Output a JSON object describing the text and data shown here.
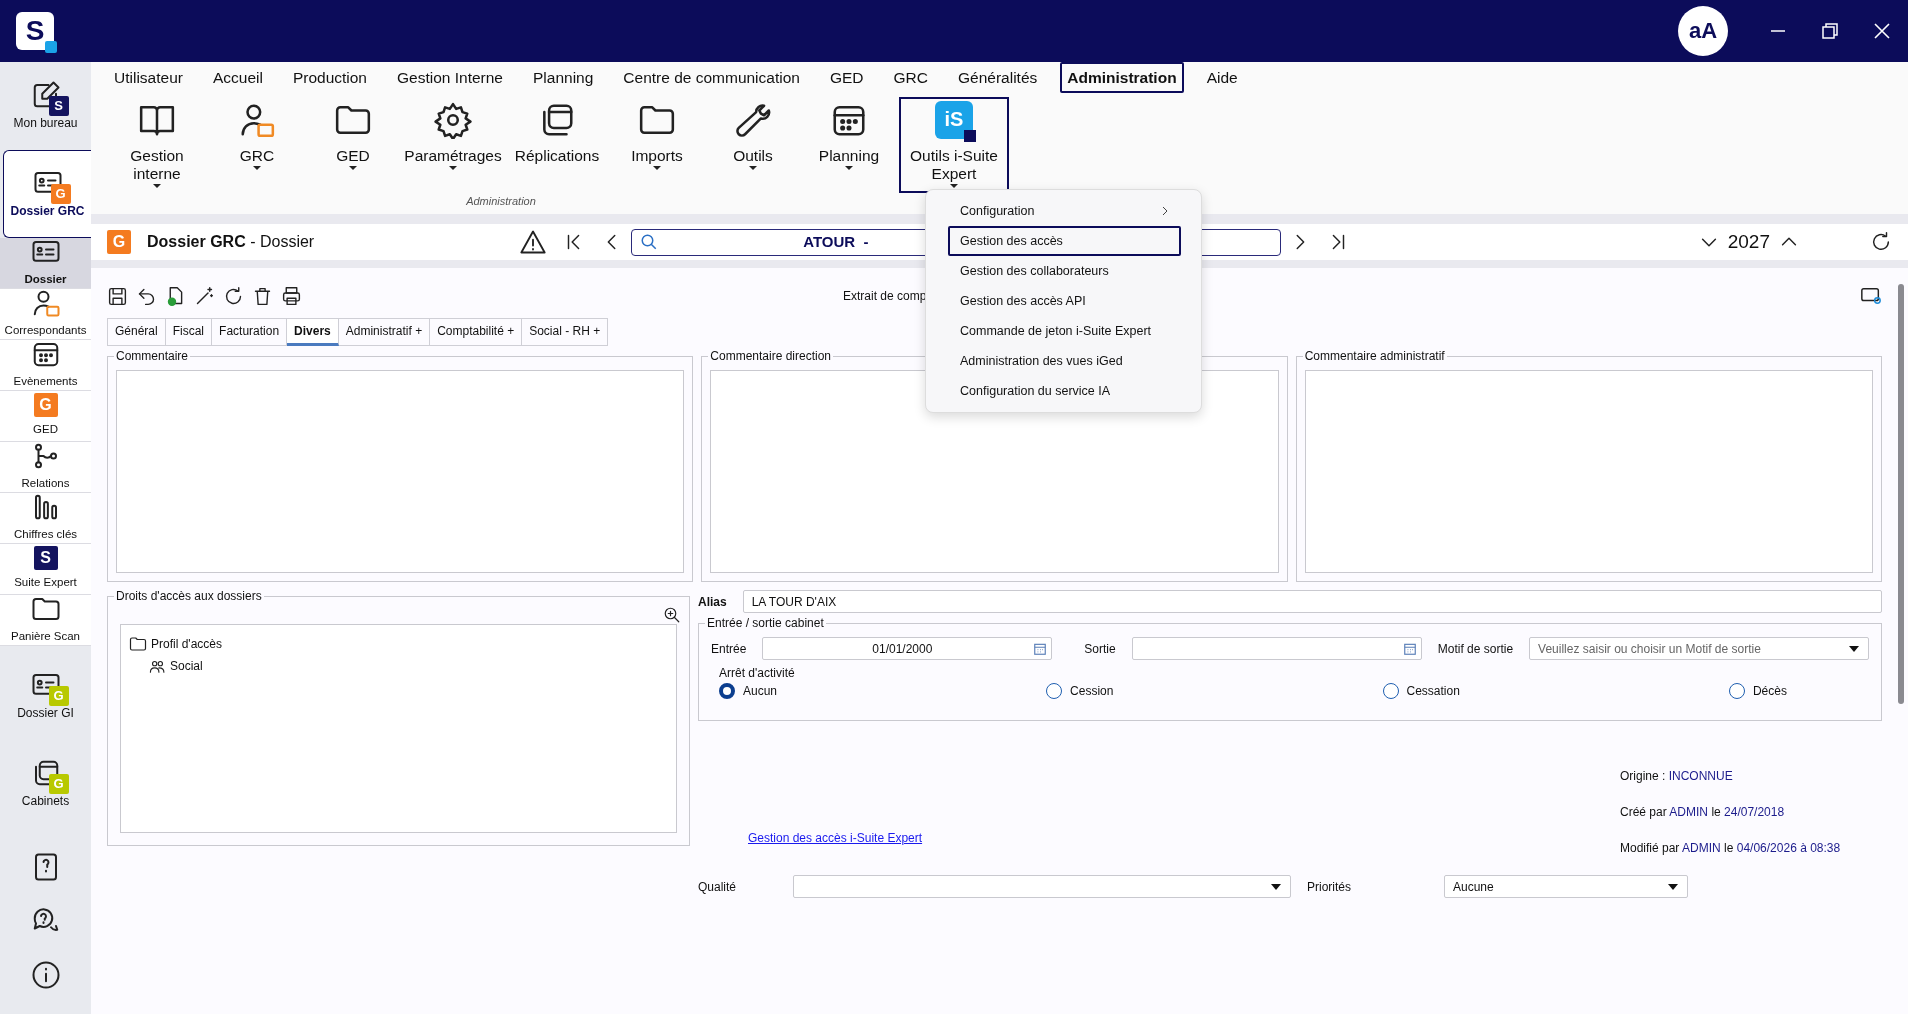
{
  "app": {
    "logo": "S",
    "avatar": "aA"
  },
  "sidebar": [
    {
      "kind": "module",
      "label": "Mon bureau",
      "badge": "S",
      "color": "#14145f",
      "selected": false
    },
    {
      "kind": "module",
      "label": "Dossier GRC",
      "badge": "G",
      "color": "#f47b20",
      "selected": true
    },
    {
      "kind": "sub",
      "label": "Dossier",
      "selected": true
    },
    {
      "kind": "sub",
      "label": "Correspondants",
      "selected": false
    },
    {
      "kind": "sub",
      "label": "Evènements",
      "selected": false
    },
    {
      "kind": "sub",
      "label": "GED",
      "badge": "G",
      "color": "#f47b20",
      "selected": false
    },
    {
      "kind": "sub",
      "label": "Relations",
      "selected": false
    },
    {
      "kind": "sub",
      "label": "Chiffres clés",
      "selected": false
    },
    {
      "kind": "sub",
      "label": "Suite Expert",
      "badge": "S",
      "color": "#14145f",
      "selected": false
    },
    {
      "kind": "sub",
      "label": "Panière Scan",
      "selected": false
    },
    {
      "kind": "module",
      "label": "Dossier GI",
      "badge": "G",
      "color": "#b8c900",
      "selected": false
    },
    {
      "kind": "module",
      "label": "Cabinets",
      "badge": "G",
      "color": "#b8c900",
      "selected": false
    }
  ],
  "menu_bar": [
    {
      "label": "Utilisateur",
      "selected": false
    },
    {
      "label": "Accueil",
      "selected": false
    },
    {
      "label": "Production",
      "selected": false
    },
    {
      "label": "Gestion Interne",
      "selected": false
    },
    {
      "label": "Planning",
      "selected": false
    },
    {
      "label": "Centre de communication",
      "selected": false
    },
    {
      "label": "GED",
      "selected": false
    },
    {
      "label": "GRC",
      "selected": false
    },
    {
      "label": "Généralités",
      "selected": false
    },
    {
      "label": "Administration",
      "selected": true
    },
    {
      "label": "Aide",
      "selected": false
    }
  ],
  "ribbon": {
    "group_label": "Administration",
    "buttons": [
      {
        "label": "Gestion interne",
        "dropdown": true,
        "selected": false
      },
      {
        "label": "GRC",
        "dropdown": true,
        "selected": false
      },
      {
        "label": "GED",
        "dropdown": true,
        "selected": false
      },
      {
        "label": "Paramétrages",
        "dropdown": true,
        "selected": false
      },
      {
        "label": "Réplications",
        "dropdown": false,
        "selected": false
      },
      {
        "label": "Imports",
        "dropdown": true,
        "selected": false
      },
      {
        "label": "Outils",
        "dropdown": true,
        "selected": false
      },
      {
        "label": "Planning",
        "dropdown": true,
        "selected": false
      },
      {
        "label": "Outils i-Suite Expert",
        "badge": "iS",
        "dropdown": true,
        "selected": true
      }
    ]
  },
  "dropdown_menu": [
    {
      "label": "Configuration",
      "submenu": true,
      "selected": false
    },
    {
      "label": "Gestion des accès",
      "submenu": false,
      "selected": true
    },
    {
      "label": "Gestion des collaborateurs",
      "submenu": false,
      "selected": false
    },
    {
      "label": "Gestion des accès API",
      "submenu": false,
      "selected": false
    },
    {
      "label": "Commande de jeton i-Suite Expert",
      "submenu": false,
      "selected": false
    },
    {
      "label": "Administration des vues iGed",
      "submenu": false,
      "selected": false
    },
    {
      "label": "Configuration du service IA",
      "submenu": false,
      "selected": false
    }
  ],
  "document_header": {
    "badge": "G",
    "title": "Dossier GRC",
    "subtitle": " - Dossier",
    "search_text": "ATOUR  -",
    "year": "2027"
  },
  "toolbar": {
    "extract_label": "Extrait de comp"
  },
  "tabs": [
    {
      "label": "Général",
      "selected": false
    },
    {
      "label": "Fiscal",
      "selected": false
    },
    {
      "label": "Facturation",
      "selected": false
    },
    {
      "label": "Divers",
      "selected": true
    },
    {
      "label": "Administratif +",
      "selected": false
    },
    {
      "label": "Comptabilité +",
      "selected": false
    },
    {
      "label": "Social - RH +",
      "selected": false
    }
  ],
  "comment_boxes": [
    {
      "title": "Commentaire"
    },
    {
      "title": "Commentaire direction"
    },
    {
      "title": "Commentaire administratif"
    }
  ],
  "access_rights": {
    "title": "Droits d'accès aux dossiers",
    "tree": [
      {
        "label": "Profil d'accès",
        "children": [
          {
            "label": "Social"
          }
        ]
      }
    ]
  },
  "alias": {
    "label": "Alias",
    "value": "LA TOUR D'AIX"
  },
  "entry_exit": {
    "title": "Entrée / sortie cabinet",
    "entry_label": "Entrée",
    "entry_value": "01/01/2000",
    "exit_label": "Sortie",
    "reason_label": "Motif de sortie",
    "reason_placeholder": "Veuillez saisir ou choisir un Motif de sortie",
    "stop_label": "Arrêt d'activité",
    "options": [
      {
        "label": "Aucun",
        "selected": true
      },
      {
        "label": "Cession",
        "selected": false
      },
      {
        "label": "Cessation",
        "selected": false
      },
      {
        "label": "Décès",
        "selected": false
      }
    ]
  },
  "link": "Gestion des accès i-Suite Expert",
  "info_lines": [
    [
      {
        "text": "Origine :",
        "value": false
      },
      {
        "text": "INCONNUE",
        "value": true
      }
    ],
    [
      {
        "text": "Créé par",
        "value": false
      },
      {
        "text": "ADMIN",
        "value": true
      },
      {
        "text": "le",
        "value": false
      },
      {
        "text": "24/07/2018",
        "value": true
      }
    ],
    [
      {
        "text": "Modifié par",
        "value": false
      },
      {
        "text": "ADMIN",
        "value": true
      },
      {
        "text": "le",
        "value": false
      },
      {
        "text": "04/06/2026 à 08:38",
        "value": true
      }
    ]
  ],
  "quality": {
    "label": "Qualité"
  },
  "priorities": {
    "label": "Priorités",
    "value": "Aucune"
  }
}
